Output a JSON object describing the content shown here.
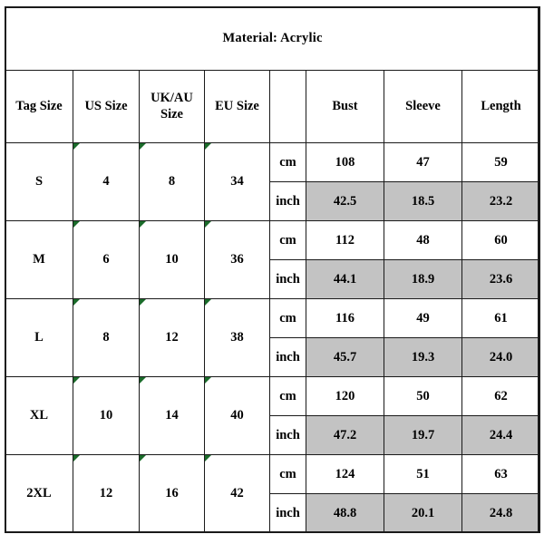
{
  "title": "Material: Acrylic",
  "headers": {
    "tag_size": "Tag Size",
    "us_size": "US Size",
    "uk_au_size": "UK/AU Size",
    "eu_size": "EU Size",
    "unit": "",
    "bust": "Bust",
    "sleeve": "Sleeve",
    "length": "Length"
  },
  "units": {
    "cm": "cm",
    "inch": "inch"
  },
  "colors": {
    "inch_row_fill": "#c3c3c3",
    "border": "#1a1a1a",
    "error_triangle": "#1a6b2a",
    "cell_background": "#ffffff",
    "text": "#000000"
  },
  "rows": [
    {
      "tag_size": "S",
      "us_size": "4",
      "uk_au_size": "8",
      "eu_size": "34",
      "cm": {
        "bust": "108",
        "sleeve": "47",
        "length": "59"
      },
      "inch": {
        "bust": "42.5",
        "sleeve": "18.5",
        "length": "23.2"
      }
    },
    {
      "tag_size": "M",
      "us_size": "6",
      "uk_au_size": "10",
      "eu_size": "36",
      "cm": {
        "bust": "112",
        "sleeve": "48",
        "length": "60"
      },
      "inch": {
        "bust": "44.1",
        "sleeve": "18.9",
        "length": "23.6"
      }
    },
    {
      "tag_size": "L",
      "us_size": "8",
      "uk_au_size": "12",
      "eu_size": "38",
      "cm": {
        "bust": "116",
        "sleeve": "49",
        "length": "61"
      },
      "inch": {
        "bust": "45.7",
        "sleeve": "19.3",
        "length": "24.0"
      }
    },
    {
      "tag_size": "XL",
      "us_size": "10",
      "uk_au_size": "14",
      "eu_size": "40",
      "cm": {
        "bust": "120",
        "sleeve": "50",
        "length": "62"
      },
      "inch": {
        "bust": "47.2",
        "sleeve": "19.7",
        "length": "24.4"
      }
    },
    {
      "tag_size": "2XL",
      "us_size": "12",
      "uk_au_size": "16",
      "eu_size": "42",
      "cm": {
        "bust": "124",
        "sleeve": "51",
        "length": "63"
      },
      "inch": {
        "bust": "48.8",
        "sleeve": "20.1",
        "length": "24.8"
      }
    }
  ]
}
